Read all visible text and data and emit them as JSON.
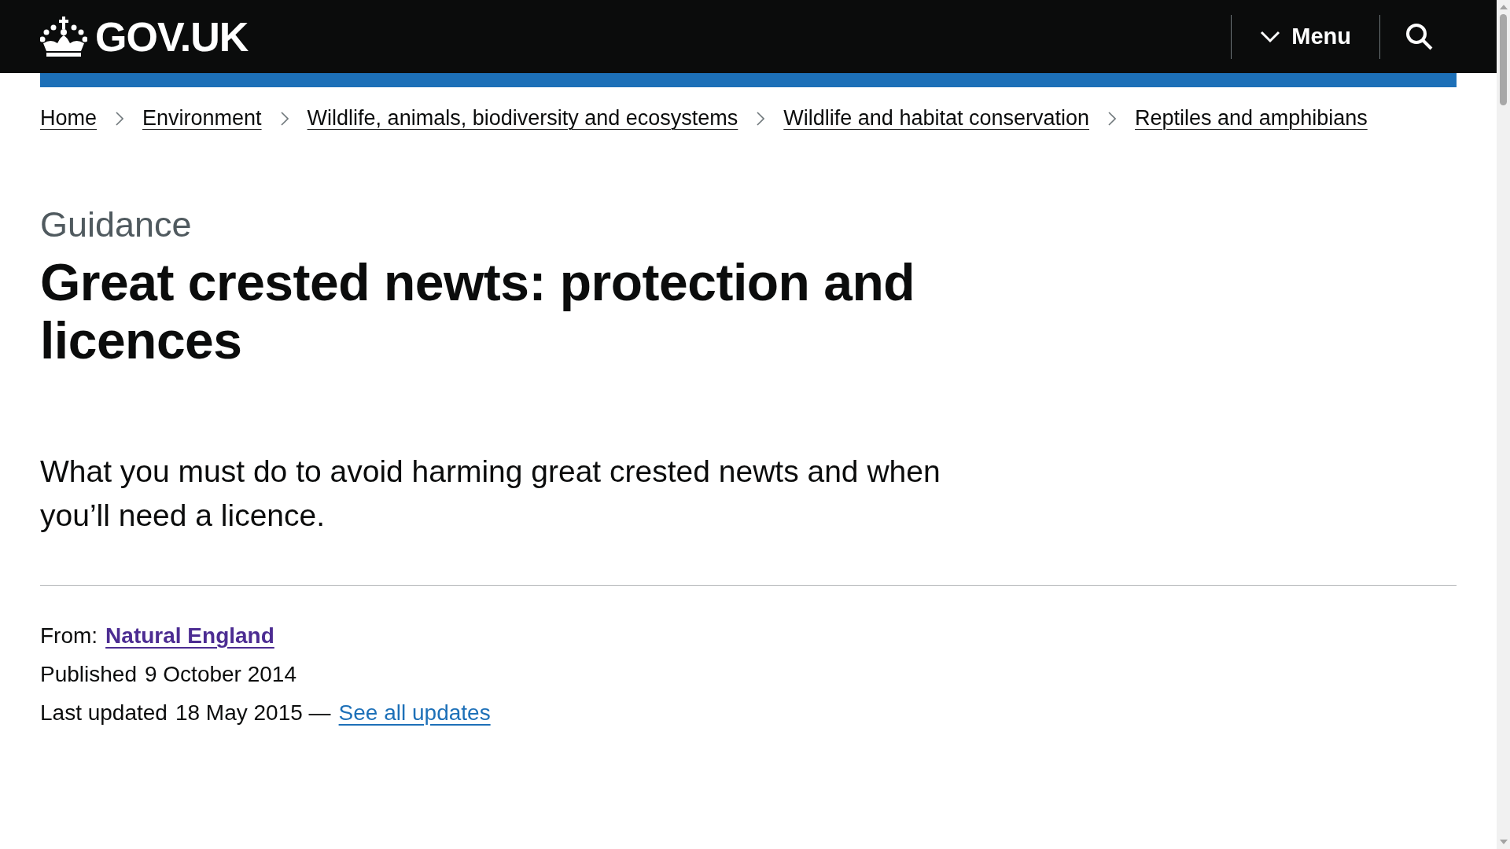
{
  "header": {
    "logo_text": "GOV.UK",
    "menu_button": "Menu"
  },
  "breadcrumbs": [
    "Home",
    "Environment",
    "Wildlife, animals, biodiversity and ecosystems",
    "Wildlife and habitat conservation",
    "Reptiles and amphibians"
  ],
  "caption": "Guidance",
  "title": "Great crested newts: protection and licences",
  "lead": "What you must do to avoid harming great crested newts and when you’ll need a licence.",
  "metadata": {
    "from_label": "From:",
    "from_link": "Natural England",
    "published_label": "Published",
    "published_date": "9 October 2014",
    "updated_label": "Last updated",
    "updated_date": "18 May 2015 —",
    "updates_link": "See all updates"
  }
}
